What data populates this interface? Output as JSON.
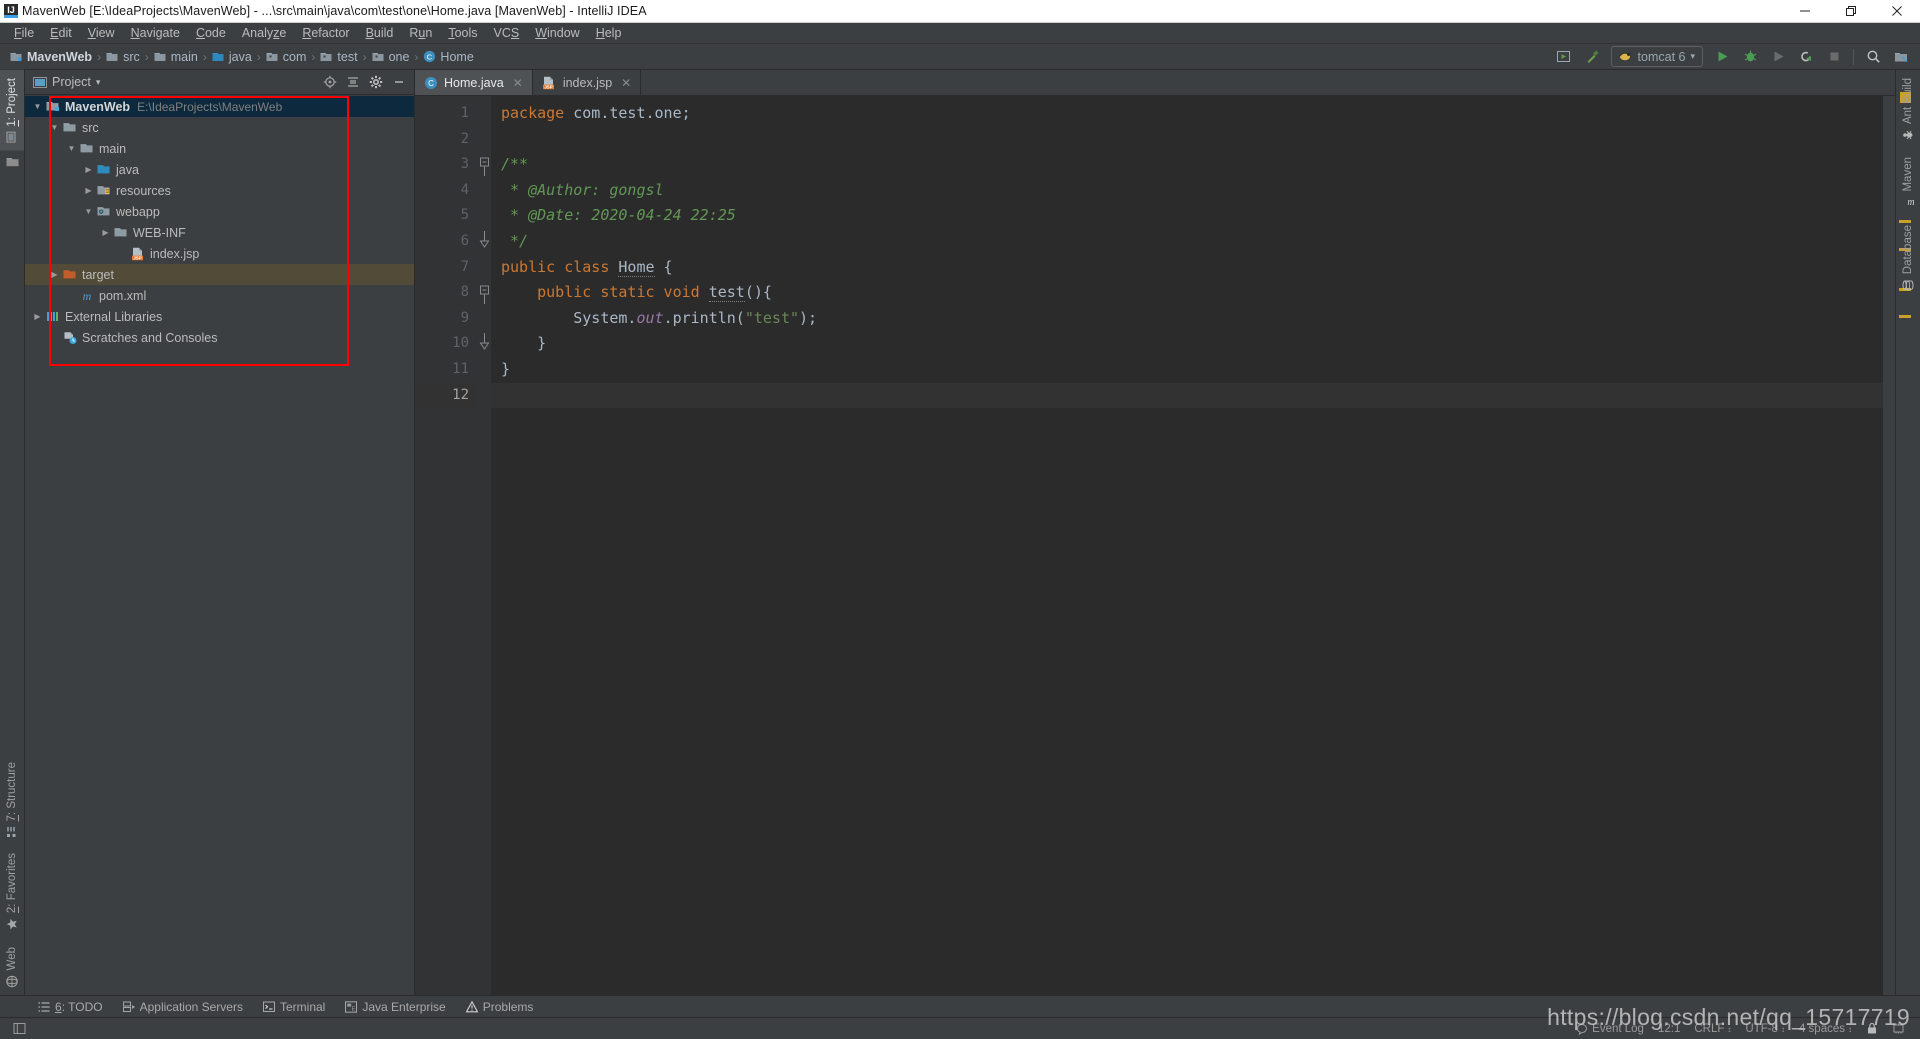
{
  "window": {
    "title": "MavenWeb [E:\\IdeaProjects\\MavenWeb] - ...\\src\\main\\java\\com\\test\\one\\Home.java [MavenWeb] - IntelliJ IDEA",
    "app_badge": "IJ",
    "minimize": "—",
    "maximize": "❐",
    "close": "✕"
  },
  "menubar": {
    "items": [
      {
        "label": "File",
        "mnemonic": "F"
      },
      {
        "label": "Edit",
        "mnemonic": "E"
      },
      {
        "label": "View",
        "mnemonic": "V"
      },
      {
        "label": "Navigate",
        "mnemonic": "N"
      },
      {
        "label": "Code",
        "mnemonic": "C"
      },
      {
        "label": "Analyze",
        "mnemonic": "z"
      },
      {
        "label": "Refactor",
        "mnemonic": "R"
      },
      {
        "label": "Build",
        "mnemonic": "B"
      },
      {
        "label": "Run",
        "mnemonic": "u"
      },
      {
        "label": "Tools",
        "mnemonic": "T"
      },
      {
        "label": "VCS",
        "mnemonic": "S"
      },
      {
        "label": "Window",
        "mnemonic": "W"
      },
      {
        "label": "Help",
        "mnemonic": "H"
      }
    ]
  },
  "navbar": {
    "breadcrumbs": [
      {
        "label": "MavenWeb",
        "icon": "module-icon",
        "bold": true
      },
      {
        "label": "src",
        "icon": "folder-icon",
        "bold": false
      },
      {
        "label": "main",
        "icon": "folder-icon",
        "bold": false
      },
      {
        "label": "java",
        "icon": "source-folder-icon",
        "bold": false
      },
      {
        "label": "com",
        "icon": "package-icon",
        "bold": false
      },
      {
        "label": "test",
        "icon": "package-icon",
        "bold": false
      },
      {
        "label": "one",
        "icon": "package-icon",
        "bold": false
      },
      {
        "label": "Home",
        "icon": "class-icon",
        "bold": false
      }
    ],
    "separator": "›",
    "run_configuration": {
      "label": "tomcat 6",
      "icon": "tomcat-icon",
      "chevron": "▾"
    },
    "actions": [
      {
        "name": "update-app-button",
        "glyph": "▶"
      },
      {
        "name": "build-hammer-button",
        "glyph": "⚒"
      },
      {
        "name": "run-button",
        "glyph": "▶"
      },
      {
        "name": "debug-button",
        "glyph": "🐞"
      },
      {
        "name": "run-with-coverage-button",
        "glyph": "▶"
      },
      {
        "name": "rerun-button",
        "glyph": "↻"
      },
      {
        "name": "stop-button",
        "glyph": "■"
      },
      {
        "name": "search-everywhere-button",
        "glyph": "🔍"
      },
      {
        "name": "project-structure-button",
        "glyph": "▦"
      }
    ]
  },
  "left_strip": {
    "top": [
      {
        "label": "1: Project",
        "mnemonic": "1",
        "active": true,
        "icon": "project-icon"
      }
    ],
    "bottom": [
      {
        "label": "7: Structure",
        "mnemonic": "7",
        "active": false,
        "icon": "structure-icon"
      },
      {
        "label": "2: Favorites",
        "mnemonic": "2",
        "active": false,
        "icon": "star-icon"
      },
      {
        "label": "Web",
        "mnemonic": "",
        "active": false,
        "icon": "web-icon"
      }
    ]
  },
  "right_strip": {
    "items": [
      {
        "label": "Ant Build",
        "icon": "ant-icon"
      },
      {
        "label": "Maven",
        "icon": "maven-icon"
      },
      {
        "label": "Database",
        "icon": "database-icon"
      }
    ]
  },
  "project_panel": {
    "title": "Project",
    "title_chevron": "▾",
    "actions": [
      {
        "name": "scroll-from-source-icon",
        "glyph": "⊕"
      },
      {
        "name": "collapse-all-icon",
        "glyph": "≡"
      },
      {
        "name": "settings-gear-icon",
        "glyph": "⚙"
      },
      {
        "name": "hide-panel-icon",
        "glyph": "—"
      }
    ],
    "tree": [
      {
        "label": "MavenWeb",
        "sub": "E:\\IdeaProjects\\MavenWeb",
        "indent": 0,
        "arrow": "down",
        "icon": "project-module-icon",
        "bold": true,
        "state": "selected"
      },
      {
        "label": "src",
        "sub": "",
        "indent": 1,
        "arrow": "down",
        "icon": "folder-icon",
        "bold": false,
        "state": ""
      },
      {
        "label": "main",
        "sub": "",
        "indent": 2,
        "arrow": "down",
        "icon": "folder-icon",
        "bold": false,
        "state": ""
      },
      {
        "label": "java",
        "sub": "",
        "indent": 3,
        "arrow": "right",
        "icon": "source-folder-icon",
        "bold": false,
        "state": ""
      },
      {
        "label": "resources",
        "sub": "",
        "indent": 3,
        "arrow": "right",
        "icon": "resources-folder-icon",
        "bold": false,
        "state": ""
      },
      {
        "label": "webapp",
        "sub": "",
        "indent": 3,
        "arrow": "down",
        "icon": "webapp-folder-icon",
        "bold": false,
        "state": ""
      },
      {
        "label": "WEB-INF",
        "sub": "",
        "indent": 4,
        "arrow": "right",
        "icon": "folder-icon",
        "bold": false,
        "state": ""
      },
      {
        "label": "index.jsp",
        "sub": "",
        "indent": 5,
        "arrow": "none",
        "icon": "jsp-file-icon",
        "bold": false,
        "state": ""
      },
      {
        "label": "target",
        "sub": "",
        "indent": 1,
        "arrow": "right",
        "icon": "excluded-folder-icon",
        "bold": false,
        "state": "excluded"
      },
      {
        "label": "pom.xml",
        "sub": "",
        "indent": 2,
        "arrow": "none",
        "icon": "maven-pom-icon",
        "bold": false,
        "state": ""
      },
      {
        "label": "External Libraries",
        "sub": "",
        "indent": 0,
        "arrow": "right",
        "icon": "libraries-icon",
        "bold": false,
        "state": ""
      },
      {
        "label": "Scratches and Consoles",
        "sub": "",
        "indent": 1,
        "arrow": "none",
        "icon": "scratches-icon",
        "bold": false,
        "state": ""
      }
    ]
  },
  "editor": {
    "tabs": [
      {
        "label": "Home.java",
        "icon": "java-class-icon",
        "active": true,
        "close": "✕"
      },
      {
        "label": "index.jsp",
        "icon": "jsp-file-icon",
        "active": false,
        "close": "✕"
      }
    ],
    "line_numbers": [
      "1",
      "2",
      "3",
      "4",
      "5",
      "6",
      "7",
      "8",
      "9",
      "10",
      "11",
      "12"
    ],
    "current_line": 12,
    "code_lines": [
      {
        "n": 1,
        "tokens": [
          {
            "t": "package ",
            "c": "kw"
          },
          {
            "t": "com.test.one;",
            "c": "plain"
          }
        ]
      },
      {
        "n": 2,
        "tokens": []
      },
      {
        "n": 3,
        "tokens": [
          {
            "t": "/**",
            "c": "cmt"
          }
        ],
        "fold": "start"
      },
      {
        "n": 4,
        "tokens": [
          {
            "t": " * @Author: gongsl",
            "c": "cmt"
          }
        ]
      },
      {
        "n": 5,
        "tokens": [
          {
            "t": " * @Date: 2020-04-24 22:25",
            "c": "cmt"
          }
        ]
      },
      {
        "n": 6,
        "tokens": [
          {
            "t": " */",
            "c": "cmt"
          }
        ],
        "fold": "end"
      },
      {
        "n": 7,
        "tokens": [
          {
            "t": "public class ",
            "c": "kw"
          },
          {
            "t": "Home",
            "c": "wavy"
          },
          {
            "t": " {",
            "c": "plain"
          }
        ]
      },
      {
        "n": 8,
        "tokens": [
          {
            "t": "    public static void ",
            "c": "kw"
          },
          {
            "t": "test",
            "c": "wavy"
          },
          {
            "t": "(){",
            "c": "plain"
          }
        ],
        "fold": "start"
      },
      {
        "n": 9,
        "tokens": [
          {
            "t": "        System.",
            "c": "plain"
          },
          {
            "t": "out",
            "c": "fld"
          },
          {
            "t": ".println(",
            "c": "plain"
          },
          {
            "t": "\"test\"",
            "c": "str"
          },
          {
            "t": ");",
            "c": "plain"
          }
        ]
      },
      {
        "n": 10,
        "tokens": [
          {
            "t": "    }",
            "c": "plain"
          }
        ],
        "fold": "end"
      },
      {
        "n": 11,
        "tokens": [
          {
            "t": "}",
            "c": "plain"
          }
        ]
      },
      {
        "n": 12,
        "tokens": []
      }
    ]
  },
  "bottom_tabs": [
    {
      "label": "6: TODO",
      "mnemonic": "6",
      "icon": "todo-icon"
    },
    {
      "label": "Application Servers",
      "mnemonic": "",
      "icon": "app-servers-icon"
    },
    {
      "label": "Terminal",
      "mnemonic": "",
      "icon": "terminal-icon"
    },
    {
      "label": "Java Enterprise",
      "mnemonic": "",
      "icon": "java-enterprise-icon"
    },
    {
      "label": "Problems",
      "mnemonic": "",
      "icon": "problems-icon"
    }
  ],
  "statusbar": {
    "message": "",
    "caret_position": "12:1",
    "line_separator": "CRLF",
    "encoding": "UTF-8",
    "indent": "4 spaces",
    "event_log": "Event Log",
    "chevron": "↕",
    "lock_icon": "lock-icon",
    "gc_icon": "memory-icon"
  },
  "watermark": "https://blog.csdn.net/qq_15717719",
  "colors": {
    "accent": "#3c9ee5",
    "panel_bg": "#3c3f41",
    "editor_bg": "#2b2b2b",
    "selection_bg": "#0d293e",
    "excluded_bg": "#514b38",
    "redbox": "#ff0000",
    "keyword": "#cc7832",
    "string": "#6a8759",
    "comment": "#629755",
    "field": "#9876aa"
  }
}
